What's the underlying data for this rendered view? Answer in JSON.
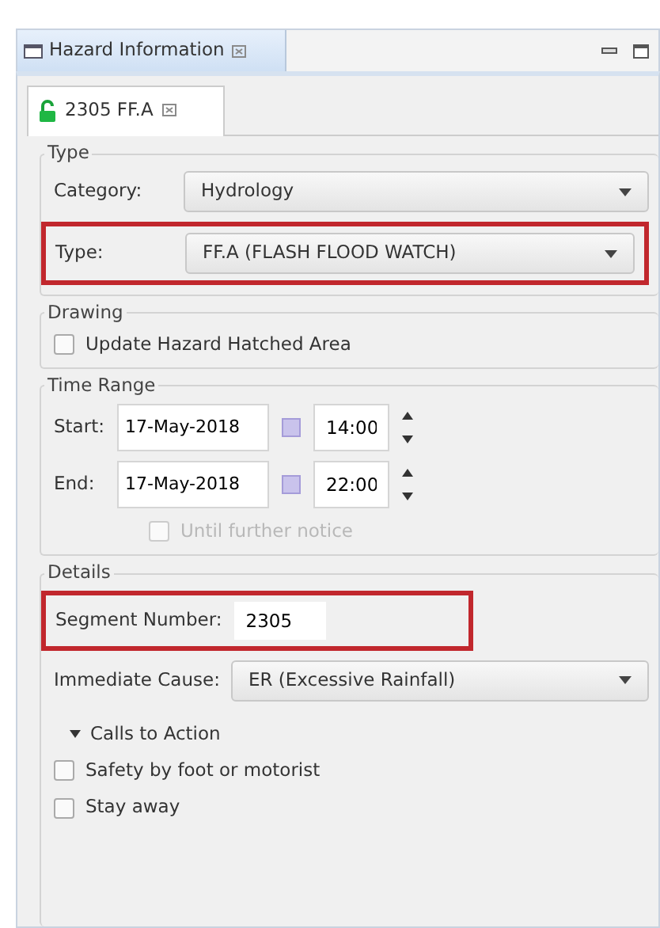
{
  "view_tab": {
    "title": "Hazard Information"
  },
  "editor_tab": {
    "title": "2305 FF.A",
    "locked": false
  },
  "groups": [
    {
      "title": "Type",
      "rows": [
        {
          "kind": "combo",
          "label": "Category:",
          "value": "Hydrology",
          "highlighted": false
        },
        {
          "kind": "combo",
          "label": "Type:",
          "value": "FF.A (FLASH FLOOD WATCH)",
          "highlighted": true
        }
      ]
    },
    {
      "title": "Drawing",
      "rows": [
        {
          "kind": "checkbox",
          "label": "Update Hazard Hatched Area",
          "checked": false,
          "disabled": false
        }
      ]
    },
    {
      "title": "Time Range",
      "rows": [
        {
          "kind": "datetime",
          "label": "Start:",
          "date": "17-May-2018",
          "time": "14:00"
        },
        {
          "kind": "datetime",
          "label": "End:",
          "date": "17-May-2018",
          "time": "22:00"
        },
        {
          "kind": "checkbox",
          "label": "Until further notice",
          "checked": false,
          "disabled": true
        }
      ]
    },
    {
      "title": "Details",
      "rows": [
        {
          "kind": "text",
          "label": "Segment Number:",
          "value": "2305",
          "highlighted": true
        },
        {
          "kind": "combo",
          "label": "Immediate Cause:",
          "value": "ER (Excessive Rainfall)",
          "highlighted": false
        },
        {
          "kind": "section",
          "label": "Calls to Action",
          "expanded": true
        },
        {
          "kind": "checkbox",
          "label": "Safety by foot or motorist",
          "checked": false,
          "disabled": false
        },
        {
          "kind": "checkbox",
          "label": "Stay away",
          "checked": false,
          "disabled": false
        }
      ]
    }
  ]
}
